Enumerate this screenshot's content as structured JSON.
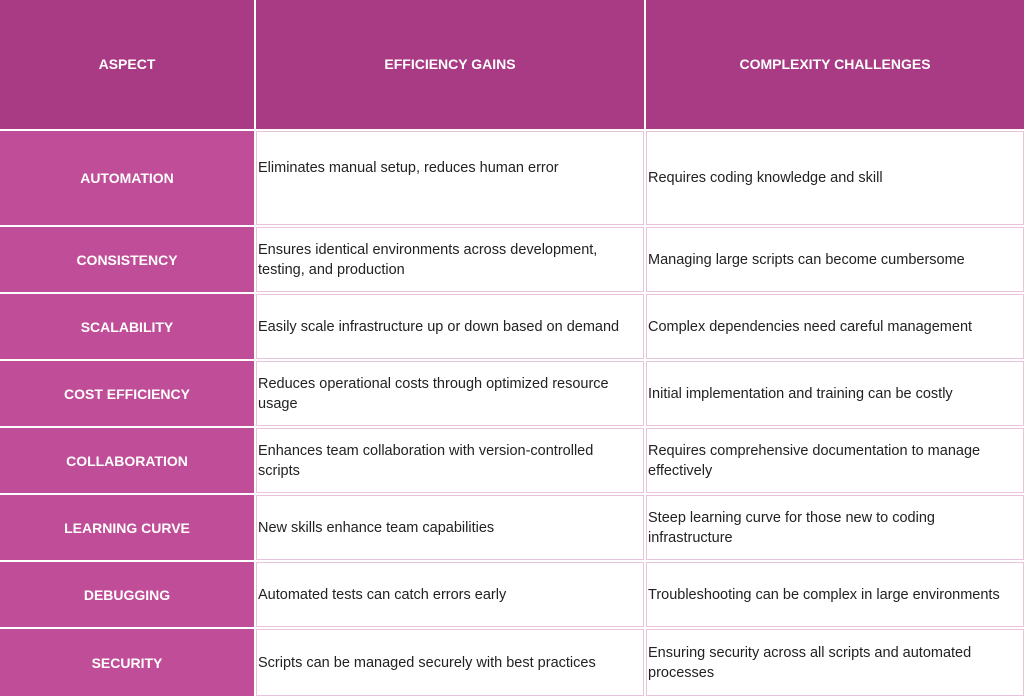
{
  "table": {
    "headers": [
      "ASPECT",
      "EFFICIENCY GAINS",
      "COMPLEXITY CHALLENGES"
    ],
    "rows": [
      {
        "aspect": "AUTOMATION",
        "gains": "Eliminates manual setup, reduces human error",
        "challenges": "Requires coding knowledge and skill"
      },
      {
        "aspect": "CONSISTENCY",
        "gains": "Ensures identical environments across development, testing, and production",
        "challenges": "Managing large scripts can become cumbersome"
      },
      {
        "aspect": "SCALABILITY",
        "gains": "Easily scale infrastructure up or down based on demand",
        "challenges": "Complex dependencies need careful management"
      },
      {
        "aspect": "COST EFFICIENCY",
        "gains": "Reduces operational costs through optimized resource usage",
        "challenges": "Initial implementation and training can be costly"
      },
      {
        "aspect": "COLLABORATION",
        "gains": "Enhances team collaboration with version-controlled scripts",
        "challenges": "Requires comprehensive documentation to manage effectively"
      },
      {
        "aspect": "LEARNING CURVE",
        "gains": "New skills enhance team capabilities",
        "challenges": "Steep learning curve for those new to coding infrastructure"
      },
      {
        "aspect": "DEBUGGING",
        "gains": "Automated tests can catch errors early",
        "challenges": "Troubleshooting can be complex in large environments"
      },
      {
        "aspect": "SECURITY",
        "gains": "Scripts can be managed securely with best practices",
        "challenges": "Ensuring security across all scripts and automated processes"
      }
    ]
  },
  "colors": {
    "header_bg": "#A93A84",
    "aspect_bg": "#C04D97",
    "cell_border": "#E8C4DC"
  }
}
